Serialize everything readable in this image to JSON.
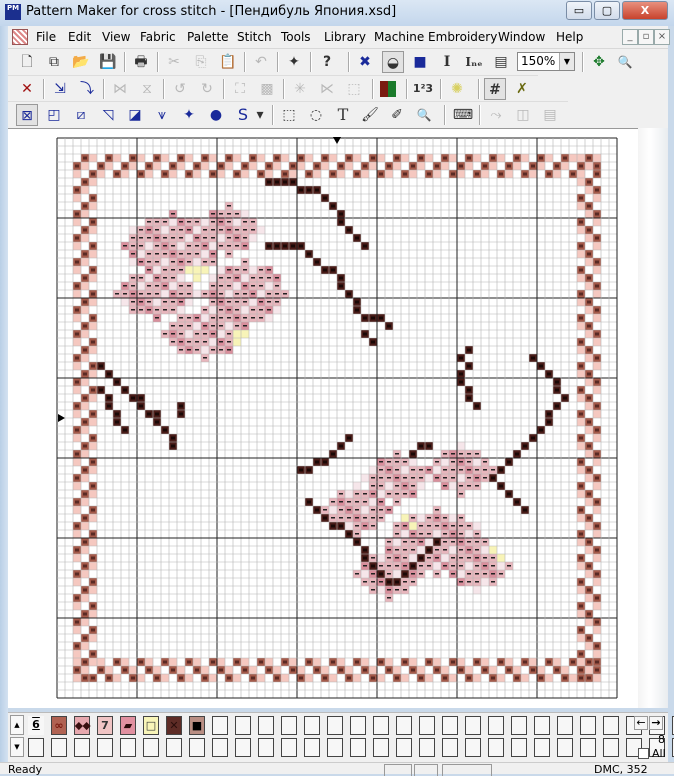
{
  "window": {
    "title": "Pattern Maker for cross stitch - [Пендибуль Япония.xsd]",
    "app_icon_label": "PM",
    "controls": {
      "minimize": "▭",
      "maximize": "▢",
      "close": "X"
    }
  },
  "menu": {
    "items": [
      {
        "label": "File",
        "accel": "F"
      },
      {
        "label": "Edit",
        "accel": "E"
      },
      {
        "label": "View",
        "accel": "V"
      },
      {
        "label": "Fabric",
        "accel": "b"
      },
      {
        "label": "Palette",
        "accel": "P"
      },
      {
        "label": "Stitch",
        "accel": "S"
      },
      {
        "label": "Tools",
        "accel": "l"
      },
      {
        "label": "Library",
        "accel": "r"
      },
      {
        "label": "Machine Embroidery",
        "accel": "M"
      },
      {
        "label": "Window",
        "accel": "W"
      },
      {
        "label": "Help",
        "accel": "H"
      }
    ],
    "mdi_controls": [
      "_",
      "▫",
      "×"
    ]
  },
  "toolbar": {
    "row1": [
      {
        "name": "new",
        "glyph": "🗋"
      },
      {
        "name": "new-from",
        "glyph": "⧉"
      },
      {
        "name": "open",
        "glyph": "📂"
      },
      {
        "name": "save",
        "glyph": "💾"
      },
      {
        "name": "print",
        "glyph": "🖶"
      },
      {
        "name": "cut",
        "glyph": "✂"
      },
      {
        "name": "copy",
        "glyph": "⎘"
      },
      {
        "name": "paste",
        "glyph": "📋"
      },
      {
        "name": "undo",
        "glyph": "↶"
      },
      {
        "name": "import",
        "glyph": "✦"
      },
      {
        "name": "help",
        "glyph": "?"
      },
      {
        "name": "full-stitch-view",
        "glyph": "✖"
      },
      {
        "name": "symbol-view",
        "glyph": "◒"
      },
      {
        "name": "color-block-view",
        "glyph": "■"
      },
      {
        "name": "text-tool",
        "glyph": "I"
      },
      {
        "name": "text-font",
        "glyph": "Iₙₑ"
      },
      {
        "name": "notes",
        "glyph": "▤"
      },
      {
        "name": "fit-page",
        "glyph": "✥"
      },
      {
        "name": "zoom-find",
        "glyph": "🔍"
      }
    ],
    "zoom_value": "150%",
    "row2": [
      {
        "name": "delete",
        "glyph": "✕"
      },
      {
        "name": "replace-color",
        "glyph": "⇲"
      },
      {
        "name": "replace-stitch",
        "glyph": "⤵"
      },
      {
        "name": "flip-horizontal",
        "glyph": "⋈"
      },
      {
        "name": "flip-vertical",
        "glyph": "⧖"
      },
      {
        "name": "rotate-left",
        "glyph": "↺"
      },
      {
        "name": "rotate-right",
        "glyph": "↻"
      },
      {
        "name": "select-shape",
        "glyph": "⛶"
      },
      {
        "name": "fill-shape",
        "glyph": "▩"
      },
      {
        "name": "mirror-all",
        "glyph": "✳"
      },
      {
        "name": "mirror-half",
        "glyph": "⋉"
      },
      {
        "name": "select-all",
        "glyph": "⬚"
      },
      {
        "name": "color-palette",
        "glyph": "▦"
      },
      {
        "name": "numbering",
        "glyph": "1²3"
      },
      {
        "name": "highlight",
        "glyph": "✺"
      },
      {
        "name": "grid",
        "glyph": "#"
      },
      {
        "name": "cross",
        "glyph": "✗"
      }
    ],
    "row3": [
      {
        "name": "full-stitch",
        "glyph": "⊠"
      },
      {
        "name": "quarter-stitch",
        "glyph": "◰"
      },
      {
        "name": "half-stitch",
        "glyph": "⧄"
      },
      {
        "name": "three-quarter-stitch",
        "glyph": "◹"
      },
      {
        "name": "half-stitch-reverse",
        "glyph": "◪"
      },
      {
        "name": "backstitch",
        "glyph": "⩛"
      },
      {
        "name": "french-knot",
        "glyph": "✦"
      },
      {
        "name": "bead",
        "glyph": "●"
      },
      {
        "name": "special-stitch",
        "glyph": "S"
      },
      {
        "name": "special-dropdown",
        "glyph": "▾"
      },
      {
        "name": "rect-select",
        "glyph": "⬚"
      },
      {
        "name": "lasso-select",
        "glyph": "◌"
      },
      {
        "name": "text",
        "glyph": "T"
      },
      {
        "name": "fill-bucket",
        "glyph": "🖌"
      },
      {
        "name": "eyedropper",
        "glyph": "✐"
      },
      {
        "name": "magnify",
        "glyph": "🔍"
      },
      {
        "name": "machine",
        "glyph": "⌨"
      },
      {
        "name": "backstitch-tool",
        "glyph": "⤳"
      },
      {
        "name": "split-view",
        "glyph": "◫"
      },
      {
        "name": "page",
        "glyph": "▤"
      }
    ]
  },
  "palette": {
    "row1": [
      {
        "symbol": "6",
        "bg": "#f7f7f7",
        "fg": "#000",
        "selected": true
      },
      {
        "symbol": "∞",
        "bg": "#b06252",
        "fg": "#7a1a10"
      },
      {
        "symbol": "⬥⬥",
        "bg": "#e7a8ae",
        "fg": "#3a1010"
      },
      {
        "symbol": "7",
        "bg": "#f0c4c4",
        "fg": "#333"
      },
      {
        "symbol": "▰",
        "bg": "#e190a0",
        "fg": "#2a0a0a"
      },
      {
        "symbol": "□",
        "bg": "#f8f4b8",
        "fg": "#333"
      },
      {
        "symbol": "✕",
        "bg": "#5e2c26",
        "fg": "#2a0e0c"
      },
      {
        "symbol": "■",
        "bg": "#b98e83",
        "fg": "#000"
      }
    ],
    "empty_cells_row1": 22,
    "empty_cells_row2": 30,
    "count": "8",
    "all_label": "All",
    "nav_left": "←",
    "nav_right": "→"
  },
  "status": {
    "text": "Ready",
    "thread": "DMC, 352"
  },
  "colors": {
    "border_stitch": "#a55a4a",
    "border_dark": "#5a2a24",
    "pink": "#e8b6bd",
    "branch": "#4a1c18",
    "grid_minor": "#b4b4b4",
    "grid_major": "#222222"
  }
}
